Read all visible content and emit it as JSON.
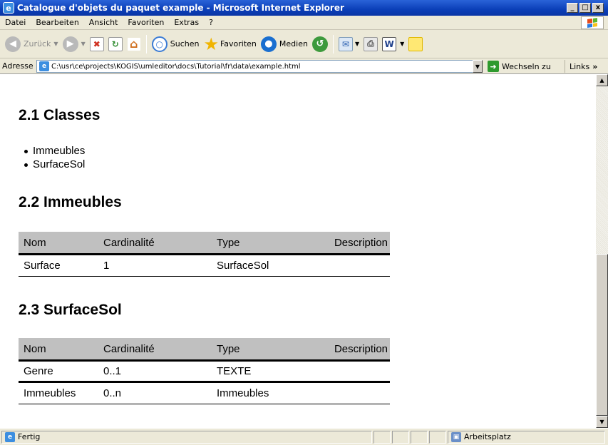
{
  "window": {
    "title": "Catalogue d'objets du paquet example - Microsoft Internet Explorer",
    "minimize": "_",
    "maximize": "□",
    "close": "x"
  },
  "menu": [
    "Datei",
    "Bearbeiten",
    "Ansicht",
    "Favoriten",
    "Extras",
    "?"
  ],
  "toolbar": {
    "back_label": "Zurück",
    "search_label": "Suchen",
    "favorites_label": "Favoriten",
    "media_label": "Medien"
  },
  "address": {
    "label": "Adresse",
    "value": "C:\\usr\\ce\\projects\\KOGIS\\umleditor\\docs\\Tutorial\\fr\\data\\example.html",
    "go_label": "Wechseln zu",
    "links_label": "Links"
  },
  "content": {
    "section_classes": {
      "heading": "2.1 Classes",
      "items": [
        "Immeubles",
        "SurfaceSol"
      ]
    },
    "section_immeubles": {
      "heading": "2.2 Immeubles",
      "columns": [
        "Nom",
        "Cardinalité",
        "Type",
        "Description"
      ],
      "rows": [
        [
          "Surface",
          "1",
          "SurfaceSol",
          ""
        ]
      ]
    },
    "section_surfacesol": {
      "heading": "2.3 SurfaceSol",
      "columns": [
        "Nom",
        "Cardinalité",
        "Type",
        "Description"
      ],
      "rows": [
        [
          "Genre",
          "0..1",
          "TEXTE",
          ""
        ],
        [
          "Immeubles",
          "0..n",
          "Immeubles",
          ""
        ]
      ]
    }
  },
  "status": {
    "text": "Fertig",
    "zone": "Arbeitsplatz"
  }
}
